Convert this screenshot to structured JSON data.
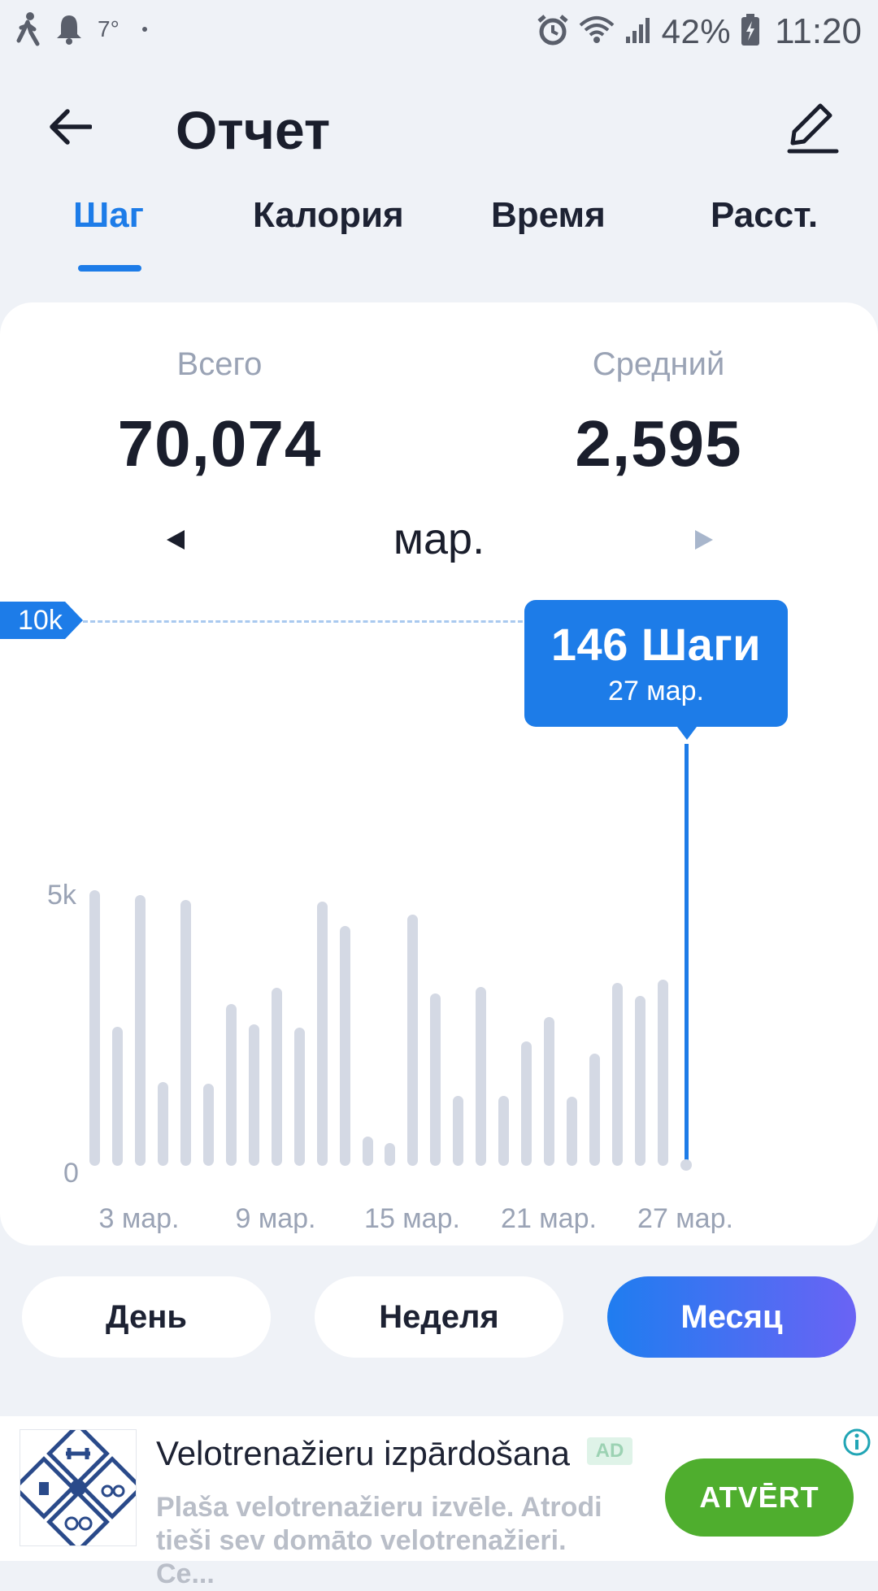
{
  "status_bar": {
    "temperature": "7°",
    "battery": "42%",
    "time": "11:20"
  },
  "header": {
    "title": "Отчет"
  },
  "tabs": [
    {
      "label": "Шаг",
      "active": true
    },
    {
      "label": "Калория",
      "active": false
    },
    {
      "label": "Время",
      "active": false
    },
    {
      "label": "Расст.",
      "active": false
    }
  ],
  "summary": {
    "total_label": "Всего",
    "total_value": "70,074",
    "average_label": "Средний",
    "average_value": "2,595",
    "month": "мар."
  },
  "chart": {
    "goal_label": "10k",
    "y_tick_labels": [
      "5k",
      "0"
    ],
    "tooltip": {
      "value": "146 Шаги",
      "date": "27 мар."
    }
  },
  "chart_data": {
    "type": "bar",
    "categories": [
      "1",
      "2",
      "3",
      "4",
      "5",
      "6",
      "7",
      "8",
      "9",
      "10",
      "11",
      "12",
      "13",
      "14",
      "15",
      "16",
      "17",
      "18",
      "19",
      "20",
      "21",
      "22",
      "23",
      "24",
      "25",
      "26",
      "27"
    ],
    "x_tick_labels": [
      "3 мар.",
      "9 мар.",
      "15 мар.",
      "21 мар.",
      "27 мар."
    ],
    "values": [
      5050,
      2550,
      4960,
      1540,
      4870,
      1500,
      2960,
      2600,
      3270,
      2530,
      4850,
      4400,
      540,
      410,
      4610,
      3160,
      1280,
      3280,
      1280,
      2280,
      2730,
      1260,
      2060,
      3350,
      3110,
      3420,
      146
    ],
    "goal": 10000,
    "ylim": [
      0,
      10000
    ],
    "y_ticks": [
      0,
      5000,
      10000
    ],
    "selected_index": 26,
    "bar_color": "#d4d9e4",
    "accent_color": "#1d7ce8"
  },
  "periods": [
    {
      "label": "День",
      "active": false
    },
    {
      "label": "Неделя",
      "active": false
    },
    {
      "label": "Месяц",
      "active": true
    }
  ],
  "ad": {
    "title": "Velotrenažieru izpārdošana",
    "badge": "AD",
    "description": "Plaša velotrenažieru izvēle. Atrodi tieši sev domāto velotrenažieri. Ce...",
    "cta": "ATVĒRT"
  }
}
